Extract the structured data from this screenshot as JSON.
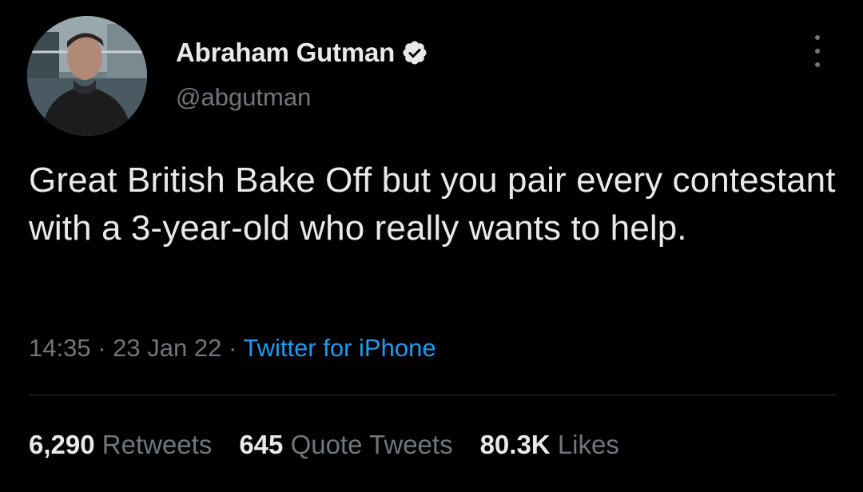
{
  "author": {
    "display_name": "Abraham Gutman",
    "handle": "@abgutman",
    "verified_icon": "verified-badge-icon",
    "avatar": "profile-photo"
  },
  "menu": {
    "icon": "more-options-icon"
  },
  "tweet": {
    "text": "Great British Bake Off but you pair every contestant with a 3-year-old who really wants to help.",
    "time": "14:35",
    "date": "23 Jan 22",
    "separator": "·",
    "source": "Twitter for iPhone"
  },
  "stats": {
    "retweets": {
      "count": "6,290",
      "label": "Retweets"
    },
    "quote_tweets": {
      "count": "645",
      "label": "Quote Tweets"
    },
    "likes": {
      "count": "80.3K",
      "label": "Likes"
    }
  },
  "colors": {
    "background": "#000000",
    "primary_text": "#e7e9ea",
    "secondary_text": "#71767b",
    "link": "#1d9bf0",
    "divider": "#2f3336"
  }
}
